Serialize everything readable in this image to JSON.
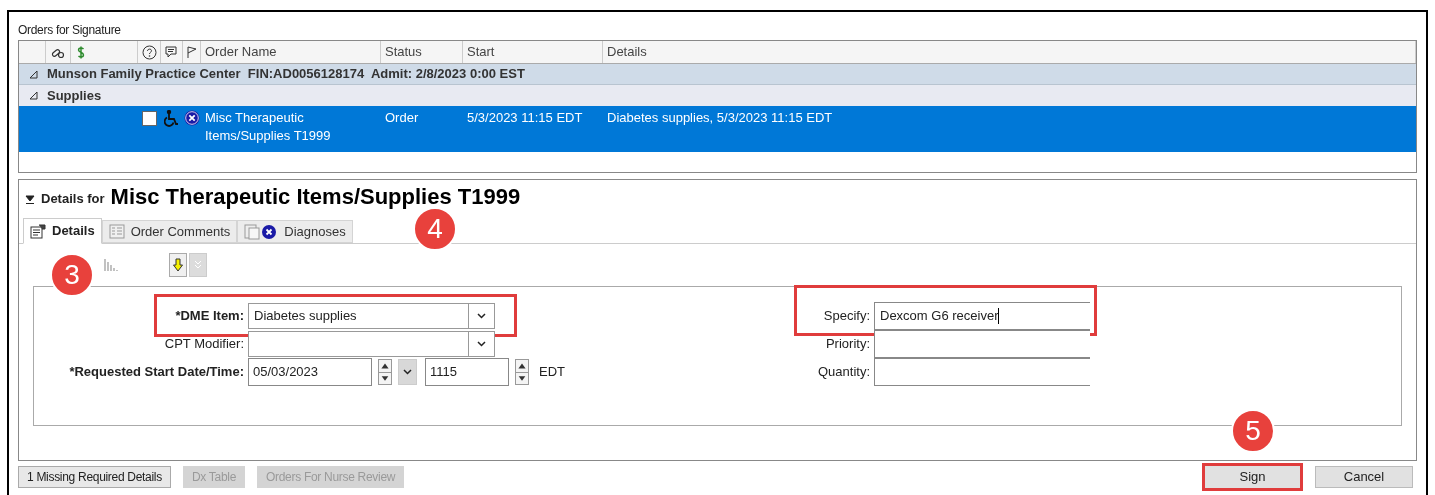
{
  "panel_title": "Orders for Signature",
  "table": {
    "columns": [
      "Order Name",
      "Status",
      "Start",
      "Details"
    ],
    "groups": [
      {
        "label": "Munson Family Practice Center  FIN:AD0056128174  Admit: 2/8/2023 0:00 EST",
        "expanded": true,
        "kind": "encounter"
      },
      {
        "label": "Supplies",
        "expanded": true,
        "kind": "category"
      }
    ],
    "rows": [
      {
        "checked": false,
        "selected": true,
        "order_name": "Misc Therapeutic Items/Supplies T1999",
        "status": "Order",
        "start": "5/3/2023 11:15 EDT",
        "details": "Diabetes supplies, 5/3/2023 11:15 EDT"
      }
    ]
  },
  "details": {
    "prefix": "Details for",
    "title": "Misc Therapeutic Items/Supplies T1999",
    "expanded": true,
    "tabs": [
      {
        "label": "Details",
        "selected": true
      },
      {
        "label": "Order Comments",
        "selected": false
      },
      {
        "label": "Diagnoses",
        "selected": false
      }
    ],
    "fields_left": [
      {
        "kind": "dropdown",
        "label": "*DME Item:",
        "required": true,
        "value": "Diabetes supplies",
        "highlighted": true
      },
      {
        "kind": "dropdown",
        "label": "CPT Modifier:",
        "required": false,
        "highlighted": false
      },
      {
        "kind": "datetime",
        "label": "*Requested Start Date/Time:",
        "required": true,
        "date": "05/03/2023",
        "time": "1115",
        "zone": "EDT",
        "highlighted": false
      }
    ],
    "fields_right": [
      {
        "label": "Specify:",
        "value": "Dexcom G6 receiver",
        "highlighted": true
      },
      {
        "label": "Priority:",
        "highlighted": false
      },
      {
        "label": "Quantity:",
        "highlighted": false
      }
    ]
  },
  "footer_buttons": [
    {
      "label": "1 Missing Required Details",
      "disabled": false
    },
    {
      "label": "Dx Table",
      "disabled": true
    },
    {
      "label": "Orders For Nurse Review",
      "disabled": true
    }
  ],
  "actions": [
    {
      "label": "Sign",
      "highlighted": true
    },
    {
      "label": "Cancel",
      "highlighted": false
    }
  ],
  "callouts": [
    "3",
    "4",
    "5"
  ]
}
